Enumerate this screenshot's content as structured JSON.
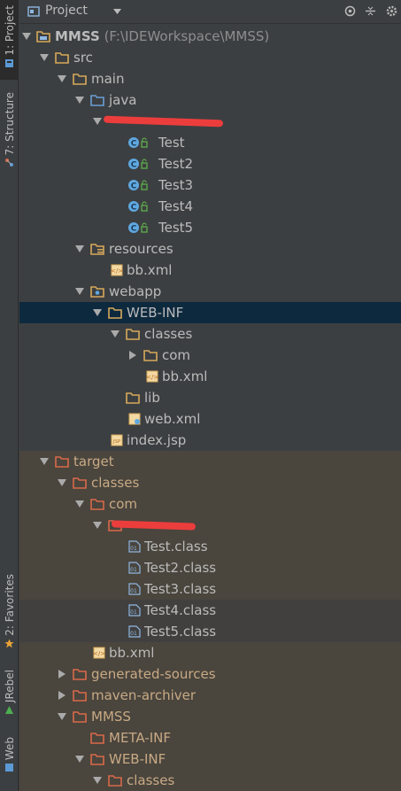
{
  "sidebar": {
    "project_tab": "1: Project",
    "structure_tab": "7: Structure",
    "favorites_tab": "2: Favorites",
    "jrebel_tab": "JRebel",
    "web_tab": "Web"
  },
  "header": {
    "title": "Project",
    "icons": [
      "project-icon",
      "chevron-down-icon",
      "locate-icon",
      "collapse-all-icon",
      "settings-icon"
    ]
  },
  "tree": {
    "root_name": "MMSS",
    "root_path": "(F:\\IDEWorkspace\\MMSS)",
    "src": "src",
    "main": "main",
    "java": "java",
    "test1": "Test",
    "test2": "Test2",
    "test3": "Test3",
    "test4": "Test4",
    "test5": "Test5",
    "resources": "resources",
    "res_bbxml": "bb.xml",
    "webapp": "webapp",
    "webinf": "WEB-INF",
    "classes": "classes",
    "com": "com",
    "classes_bbxml": "bb.xml",
    "lib": "lib",
    "webxml": "web.xml",
    "indexjsp": "index.jsp",
    "target": "target",
    "t_classes": "classes",
    "t_com": "com",
    "tc1": "Test.class",
    "tc2": "Test2.class",
    "tc3": "Test3.class",
    "tc4": "Test4.class",
    "tc5": "Test5.class",
    "t_bbxml": "bb.xml",
    "generated_sources": "generated-sources",
    "maven_archiver": "maven-archiver",
    "mmss": "MMSS",
    "metainf": "META-INF",
    "t_webinf": "WEB-INF",
    "t_webinf_classes": "classes"
  },
  "colors": {
    "bg": "#3c3f41",
    "excluded_bg": "#4a453d",
    "selected_bg": "#0d293e",
    "folder": "#d7a95a",
    "src_folder": "#6a9fd5",
    "excluded_folder": "#d9694a",
    "class_icon": "#5fa8e0",
    "redaction": "#ec3d3d"
  }
}
